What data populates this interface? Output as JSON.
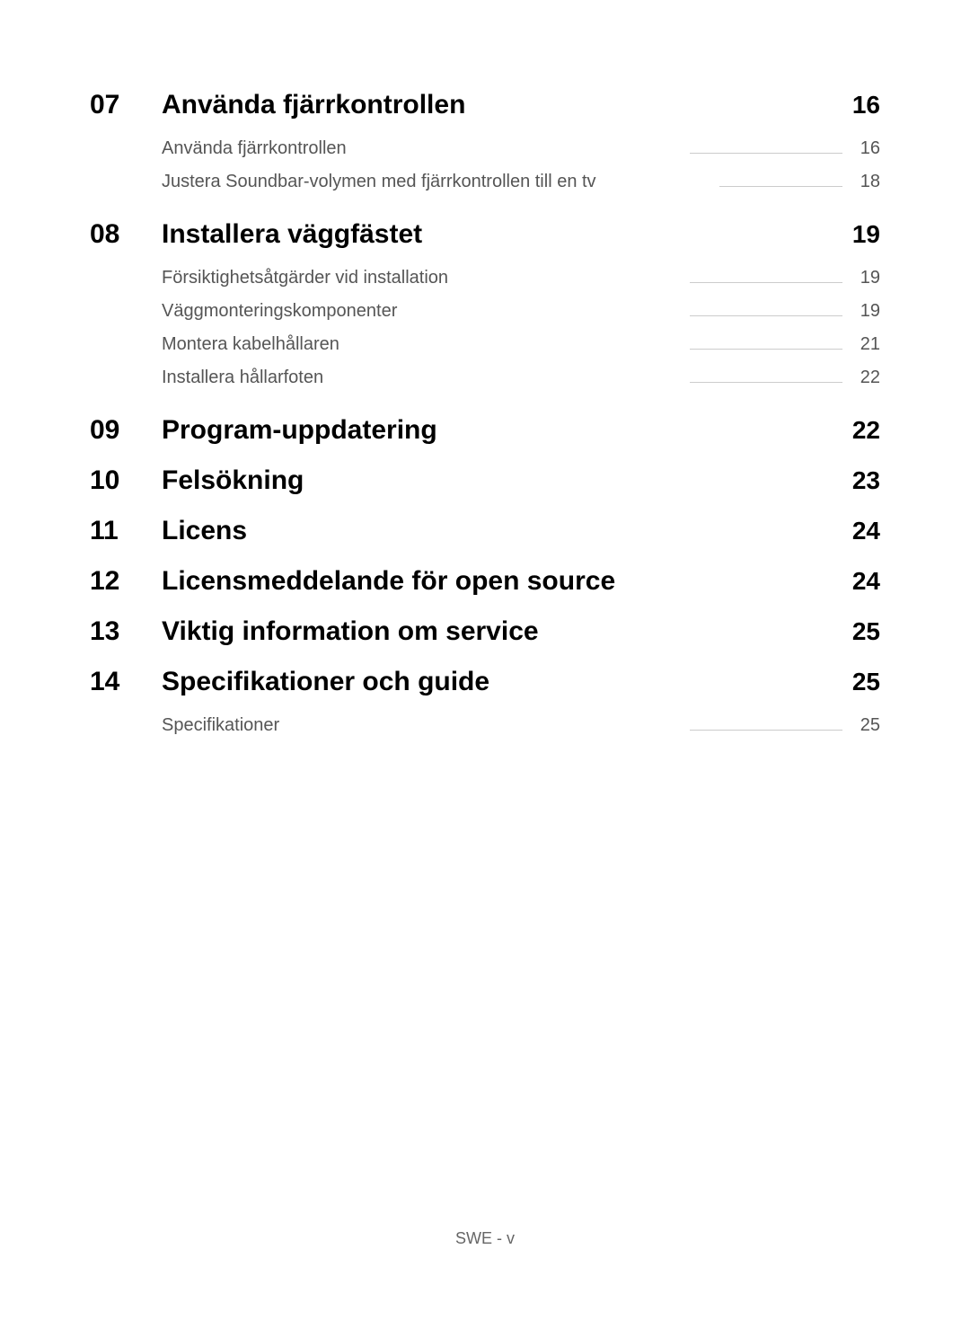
{
  "footer": "SWE - v",
  "toc": [
    {
      "number": "07",
      "title": "Använda fjärrkontrollen",
      "page": "16",
      "subs": [
        {
          "title": "Använda fjärrkontrollen",
          "page": "16"
        },
        {
          "title": "Justera Soundbar-volymen med fjärrkontrollen till en tv",
          "page": "18"
        }
      ]
    },
    {
      "number": "08",
      "title": "Installera väggfästet",
      "page": "19",
      "subs": [
        {
          "title": "Försiktighetsåtgärder vid installation",
          "page": "19"
        },
        {
          "title": "Väggmonteringskomponenter",
          "page": "19"
        },
        {
          "title": "Montera kabelhållaren",
          "page": "21"
        },
        {
          "title": "Installera hållarfoten",
          "page": "22"
        }
      ]
    },
    {
      "number": "09",
      "title": "Program-uppdatering",
      "page": "22",
      "subs": []
    },
    {
      "number": "10",
      "title": "Felsökning",
      "page": "23",
      "subs": []
    },
    {
      "number": "11",
      "title": "Licens",
      "page": "24",
      "subs": []
    },
    {
      "number": "12",
      "title": "Licensmeddelande för open source",
      "page": "24",
      "subs": []
    },
    {
      "number": "13",
      "title": "Viktig information om service",
      "page": "25",
      "subs": []
    },
    {
      "number": "14",
      "title": "Specifikationer och guide",
      "page": "25",
      "subs": [
        {
          "title": "Specifikationer",
          "page": "25"
        }
      ]
    }
  ]
}
